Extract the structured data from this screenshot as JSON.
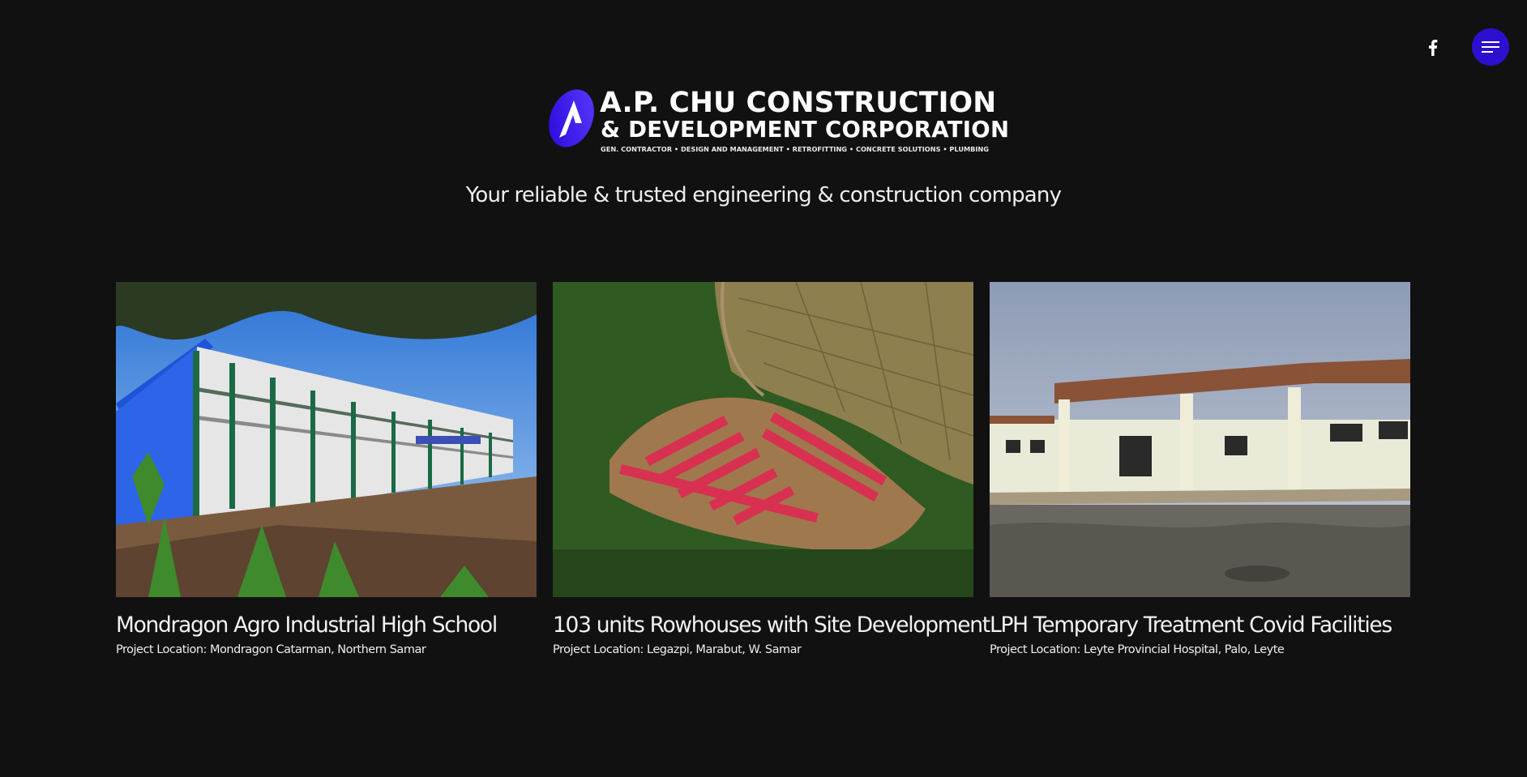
{
  "header": {
    "social": {
      "icon": "facebook-icon"
    },
    "menu": {
      "icon": "hamburger-menu-icon"
    }
  },
  "logo": {
    "line1": "A.P. CHU CONSTRUCTION",
    "line2": "& DEVELOPMENT CORPORATION",
    "line3": "GEN. CONTRACTOR • DESIGN AND MANAGEMENT • RETROFITTING • CONCRETE SOLUTIONS • PLUMBING"
  },
  "tagline": "Your reliable & trusted engineering & construction company",
  "projects": [
    {
      "title": "Mondragon Agro Industrial High School",
      "location": "Project Location: Mondragon Catarman, Northern Samar"
    },
    {
      "title": "103 units Rowhouses with Site Development",
      "location": "Project Location: Legazpi, Marabut, W. Samar"
    },
    {
      "title": "LPH Temporary Treatment Covid Facilities",
      "location": "Project Location: Leyte Provincial Hospital, Palo, Leyte"
    }
  ],
  "colors": {
    "background": "#111112",
    "accent": "#2d0fcf",
    "logo_mark": "#3a12f0",
    "text": "#ffffff"
  }
}
